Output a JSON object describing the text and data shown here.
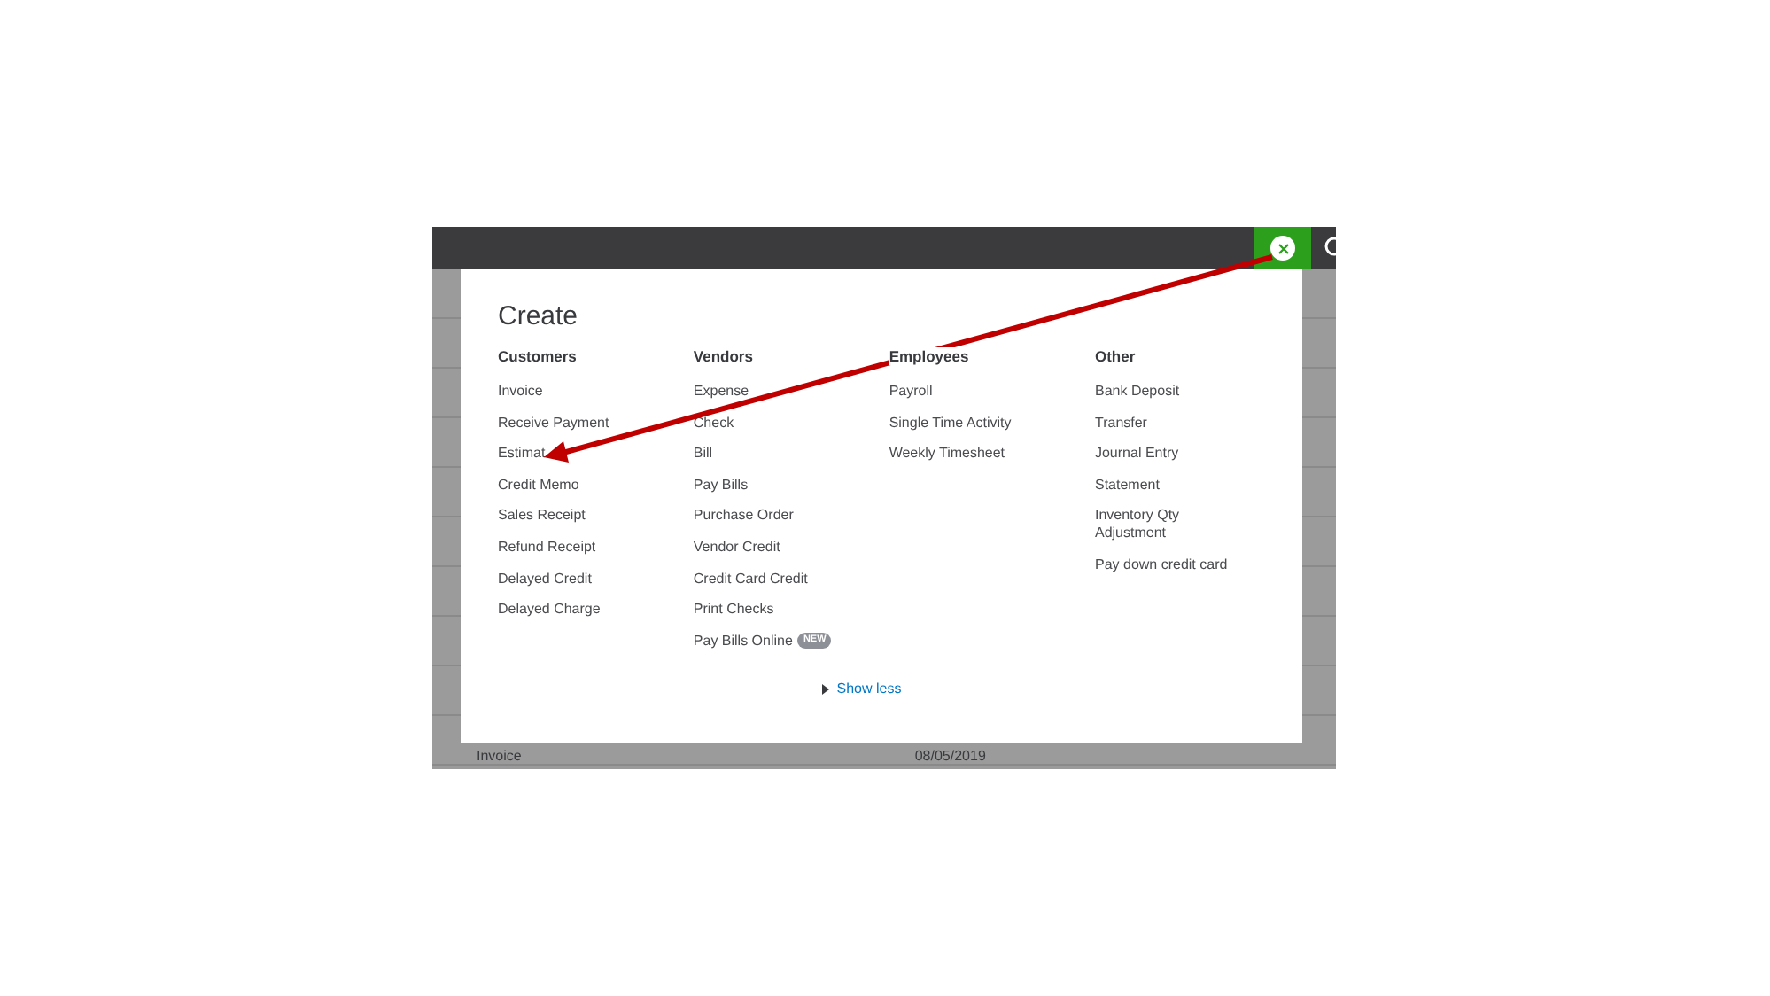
{
  "create_panel": {
    "title": "Create",
    "columns": [
      {
        "heading": "Customers",
        "items": [
          {
            "label": "Invoice"
          },
          {
            "label": "Receive Payment"
          },
          {
            "label": "Estimat"
          },
          {
            "label": "Credit Memo"
          },
          {
            "label": "Sales Receipt"
          },
          {
            "label": "Refund Receipt"
          },
          {
            "label": "Delayed Credit"
          },
          {
            "label": "Delayed Charge"
          }
        ]
      },
      {
        "heading": "Vendors",
        "items": [
          {
            "label": "Expense"
          },
          {
            "label": "Check"
          },
          {
            "label": "Bill"
          },
          {
            "label": "Pay Bills"
          },
          {
            "label": "Purchase Order"
          },
          {
            "label": "Vendor Credit"
          },
          {
            "label": "Credit Card Credit"
          },
          {
            "label": "Print Checks"
          },
          {
            "label": "Pay Bills Online",
            "badge": "NEW"
          }
        ]
      },
      {
        "heading": "Employees",
        "items": [
          {
            "label": "Payroll"
          },
          {
            "label": "Single Time Activity"
          },
          {
            "label": "Weekly Timesheet"
          }
        ]
      },
      {
        "heading": "Other",
        "items": [
          {
            "label": "Bank Deposit"
          },
          {
            "label": "Transfer"
          },
          {
            "label": "Journal Entry"
          },
          {
            "label": "Statement"
          },
          {
            "label": "Inventory Qty Adjustment"
          },
          {
            "label": "Pay down credit card"
          }
        ]
      }
    ],
    "toggle_link": "Show less"
  },
  "background_row": {
    "type": "Invoice",
    "date": "08/05/2019"
  },
  "annotation": {
    "kind": "arrow"
  }
}
